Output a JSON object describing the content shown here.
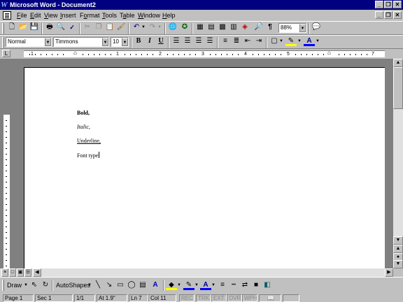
{
  "window": {
    "title": "Microsoft Word - Document2",
    "app_icon": "word-icon",
    "buttons": [
      "_",
      "❐",
      "✕"
    ]
  },
  "menu": {
    "items": [
      "File",
      "Edit",
      "View",
      "Insert",
      "Format",
      "Tools",
      "Table",
      "Window",
      "Help"
    ],
    "accel": [
      "F",
      "E",
      "V",
      "I",
      "o",
      "T",
      "a",
      "W",
      "H"
    ]
  },
  "standard_toolbar": {
    "zoom": "88%"
  },
  "formatting_toolbar": {
    "style": "Normal",
    "font": "Timmons",
    "size": "10",
    "bold": "B",
    "italic": "I",
    "underline": "U"
  },
  "ruler": {
    "numbers": [
      "1",
      "1",
      "2",
      "3",
      "4",
      "5",
      "6",
      "7"
    ]
  },
  "document": {
    "lines": [
      "Bold,",
      "Italic,",
      "Underline,",
      "Font type"
    ]
  },
  "drawing_toolbar": {
    "draw_label": "Draw",
    "autoshapes_label": "AutoShapes"
  },
  "status": {
    "page": "Page 1",
    "sec": "Sec 1",
    "page_of": "1/1",
    "at": "At 1.9\"",
    "ln": "Ln 7",
    "col": "Col 11",
    "rec": "REC",
    "trk": "TRK",
    "ext": "EXT",
    "ovr": "OVR",
    "wph": "WPH"
  },
  "colors": {
    "titlebar": "#000080",
    "highlight": "#ffff00",
    "font_color": "#0000ff"
  }
}
